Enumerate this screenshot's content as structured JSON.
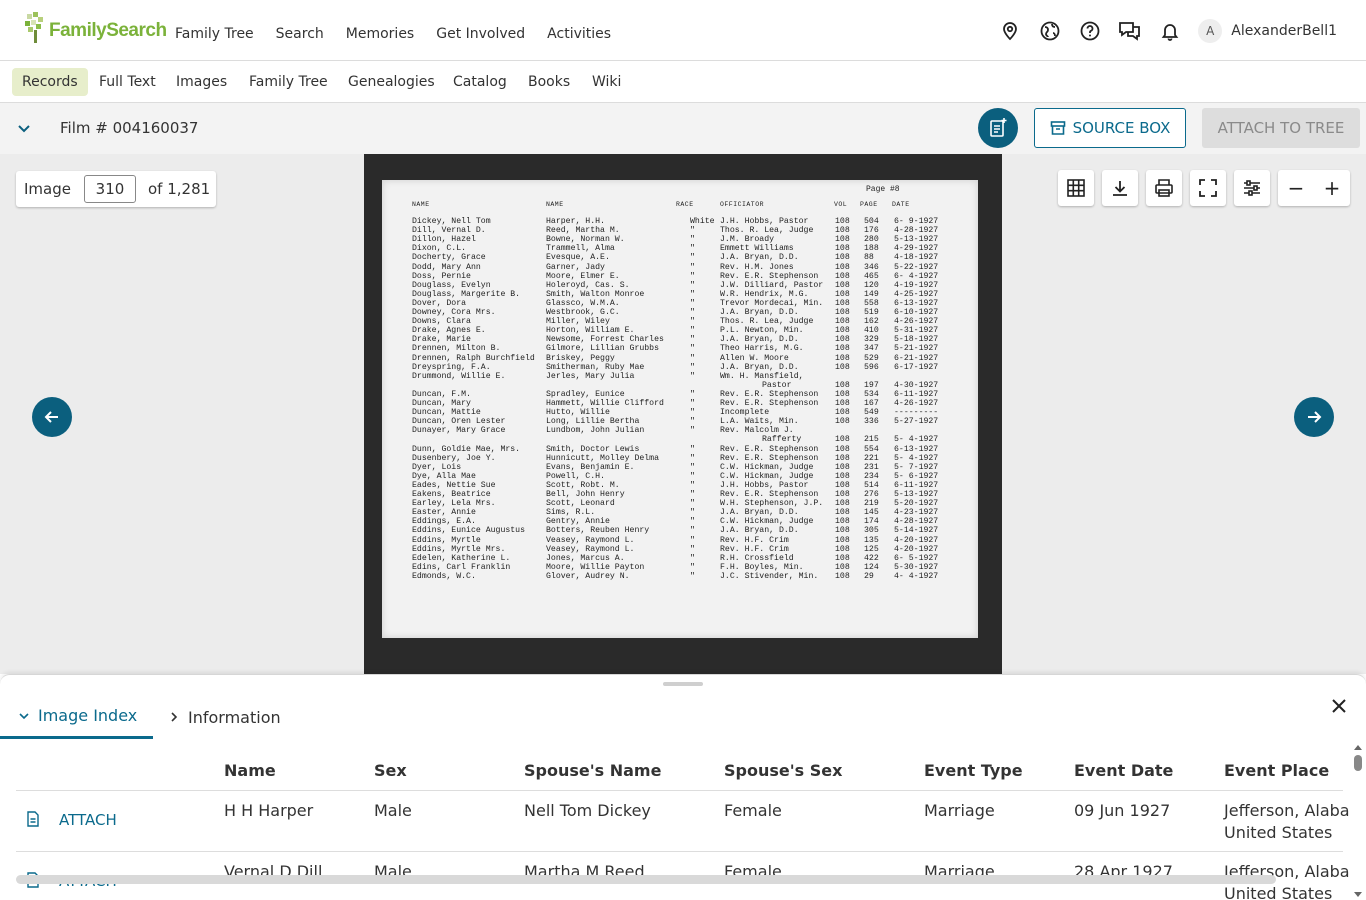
{
  "header": {
    "logo_text": "FamilySearch",
    "nav": [
      "Family Tree",
      "Search",
      "Memories",
      "Get Involved",
      "Activities"
    ],
    "icons": [
      "location-pin-icon",
      "globe-icon",
      "help-icon",
      "chat-icon",
      "bell-icon"
    ],
    "avatar_initial": "A",
    "username": "AlexanderBell1"
  },
  "subnav": {
    "items": [
      "Records",
      "Full Text",
      "Images",
      "Family Tree",
      "Genealogies",
      "Catalog",
      "Books",
      "Wiki"
    ],
    "active": "Records"
  },
  "filmbar": {
    "title": "Film # 004160037",
    "source_box_label": "SOURCE BOX",
    "attach_tree_label": "ATTACH TO TREE"
  },
  "viewer": {
    "image_label": "Image",
    "image_number": "310",
    "image_total": "of 1,281",
    "tools": [
      "grid-icon",
      "download-icon",
      "print-icon",
      "fullscreen-icon",
      "adjust-icon"
    ],
    "zoom_out": "−",
    "zoom_in": "+"
  },
  "document": {
    "page_label": "Page #8",
    "headers": [
      "NAME",
      "NAME",
      "RACE",
      "OFFICIATOR",
      "VOL",
      "PAGE",
      "DATE"
    ],
    "rows": [
      [
        "Dickey, Nell Tom",
        "Harper, H.H.",
        "White",
        "J.H. Hobbs, Pastor",
        "108",
        "504",
        "6- 9-1927"
      ],
      [
        "Dill, Vernal D.",
        "Reed, Martha M.",
        "\"",
        "Thos. R. Lea, Judge",
        "108",
        "176",
        "4-28-1927"
      ],
      [
        "Dillon, Hazel",
        "Bowne, Norman W.",
        "\"",
        "J.M. Broady",
        "108",
        "280",
        "5-13-1927"
      ],
      [
        "Dixon, C.L.",
        "Trammell, Alma",
        "\"",
        "Emmett Williams",
        "108",
        "188",
        "4-29-1927"
      ],
      [
        "Docherty, Grace",
        "Evesque, A.E.",
        "\"",
        "J.A. Bryan, D.D.",
        "108",
        "88",
        "4-18-1927"
      ],
      [
        "Dodd, Mary Ann",
        "Garner, Jady",
        "\"",
        "Rev. H.M. Jones",
        "108",
        "346",
        "5-22-1927"
      ],
      [
        "Doss, Pernie",
        "Moore, Elmer E.",
        "\"",
        "Rev. E.R. Stephenson",
        "108",
        "465",
        "6- 4-1927"
      ],
      [
        "Douglass, Evelyn",
        "Holeroyd, Cas. S.",
        "\"",
        "J.W. Dilliard, Pastor",
        "108",
        "120",
        "4-19-1927"
      ],
      [
        "Douglass, Margerite B.",
        "Smith, Walton Monroe",
        "\"",
        "W.R. Hendrix, M.G.",
        "108",
        "149",
        "4-25-1927"
      ],
      [
        "Dover, Dora",
        "Glassco, W.M.A.",
        "\"",
        "Trevor Mordecai, Min.",
        "108",
        "558",
        "6-13-1927"
      ],
      [
        "Downey, Cora Mrs.",
        "Westbrook, G.C.",
        "\"",
        "J.A. Bryan, D.D.",
        "108",
        "519",
        "6-10-1927"
      ],
      [
        "Downs, Clara",
        "Miller, Wiley",
        "\"",
        "Thos. R. Lea, Judge",
        "108",
        "162",
        "4-26-1927"
      ],
      [
        "Drake, Agnes E.",
        "Horton, William E.",
        "\"",
        "P.L. Newton, Min.",
        "108",
        "410",
        "5-31-1927"
      ],
      [
        "Drake, Marie",
        "Newsome, Forrest Charles",
        "\"",
        "J.A. Bryan, D.D.",
        "108",
        "329",
        "5-18-1927"
      ],
      [
        "Drennen, Milton B.",
        "Gilmore, Lillian Grubbs",
        "\"",
        "Theo Harris, M.G.",
        "108",
        "347",
        "5-21-1927"
      ],
      [
        "Drennen, Ralph Burchfield",
        "Briskey, Peggy",
        "\"",
        "Allen W. Moore",
        "108",
        "529",
        "6-21-1927"
      ],
      [
        "Dreyspring, F.A.",
        "Smitherman, Ruby Mae",
        "\"",
        "J.A. Bryan, D.D.",
        "108",
        "596",
        "6-17-1927"
      ],
      [
        "Drummond, Willie E.",
        "Jerles, Mary Julia",
        "\"",
        "Wm. H. Mansfield,",
        "",
        "",
        ""
      ],
      [
        "",
        "",
        "",
        "Pastor",
        "108",
        "197",
        "4-30-1927"
      ],
      [
        "Duncan, F.M.",
        "Spradley, Eunice",
        "\"",
        "Rev. E.R. Stephenson",
        "108",
        "534",
        "6-11-1927"
      ],
      [
        "Duncan, Mary",
        "Hammett, Willie Clifford",
        "\"",
        "Rev. E.R. Stephenson",
        "108",
        "167",
        "4-26-1927"
      ],
      [
        "Duncan, Mattie",
        "Hutto, Willie",
        "\"",
        "Incomplete",
        "108",
        "549",
        "---------"
      ],
      [
        "Duncan, Oren Lester",
        "Long, Lillie Bertha",
        "\"",
        "L.A. Waits, Min.",
        "108",
        "336",
        "5-27-1927"
      ],
      [
        "Dunayer, Mary Grace",
        "Lundbom, John Julian",
        "\"",
        "Rev. Malcolm J.",
        "",
        "",
        ""
      ],
      [
        "",
        "",
        "",
        "Rafferty",
        "108",
        "215",
        "5- 4-1927"
      ],
      [
        "Dunn, Goldie Mae, Mrs.",
        "Smith, Doctor Lewis",
        "\"",
        "Rev. E.R. Stephenson",
        "108",
        "554",
        "6-13-1927"
      ],
      [
        "Dusenbery, Joe Y.",
        "Hunnicutt, Molley Delma",
        "\"",
        "Rev. E.R. Stephenson",
        "108",
        "221",
        "5- 4-1927"
      ],
      [
        "Dyer, Lois",
        "Evans, Benjamin E.",
        "\"",
        "C.W. Hickman, Judge",
        "108",
        "231",
        "5- 7-1927"
      ],
      [
        "Dye, Alla Mae",
        "Powell, C.H.",
        "\"",
        "C.W. Hickman, Judge",
        "108",
        "234",
        "5- 6-1927"
      ],
      [
        "Eades, Nettie Sue",
        "Scott, Robt. M.",
        "\"",
        "J.H. Hobbs, Pastor",
        "108",
        "514",
        "6-11-1927"
      ],
      [
        "Eakens, Beatrice",
        "Bell, John Henry",
        "\"",
        "Rev. E.R. Stephenson",
        "108",
        "276",
        "5-13-1927"
      ],
      [
        "Earley, Lela Mrs.",
        "Scott, Leonard",
        "\"",
        "W.H. Stephenson, J.P.",
        "108",
        "219",
        "5-20-1927"
      ],
      [
        "Easter, Annie",
        "Sims, R.L.",
        "\"",
        "J.A. Bryan, D.D.",
        "108",
        "145",
        "4-23-1927"
      ],
      [
        "Eddings, E.A.",
        "Gentry, Annie",
        "\"",
        "C.W. Hickman, Judge",
        "108",
        "174",
        "4-28-1927"
      ],
      [
        "Eddins, Eunice Augustus",
        "Botters, Reuben Henry",
        "\"",
        "J.A. Bryan, D.D.",
        "108",
        "305",
        "5-14-1927"
      ],
      [
        "Eddins, Myrtle",
        "Veasey, Raymond L.",
        "\"",
        "Rev. H.F. Crim",
        "108",
        "135",
        "4-20-1927"
      ],
      [
        "Eddins, Myrtle Mrs.",
        "Veasey, Raymond L.",
        "\"",
        "Rev. H.F. Crim",
        "108",
        "125",
        "4-20-1927"
      ],
      [
        "Edelen, Katherine L.",
        "Jones, Marcus A.",
        "\"",
        "R.H. Crossfield",
        "108",
        "422",
        "6- 5-1927"
      ],
      [
        "Edins, Carl Franklin",
        "Moore, Willie Payton",
        "\"",
        "F.H. Boyles, Min.",
        "108",
        "124",
        "5-30-1927"
      ],
      [
        "Edmonds, W.C.",
        "Glover, Audrey N.",
        "\"",
        "J.C. Stivender, Min.",
        "108",
        "29",
        "4- 4-1927"
      ]
    ]
  },
  "panel": {
    "tab_index": "Image Index",
    "tab_info": "Information",
    "columns": [
      "Name",
      "Sex",
      "Spouse's Name",
      "Spouse's Sex",
      "Event Type",
      "Event Date",
      "Event Place"
    ],
    "attach_label": "ATTACH",
    "rows": [
      {
        "name": "H H Harper",
        "sex": "Male",
        "spouse": "Nell Tom Dickey",
        "spouse_sex": "Female",
        "event_type": "Marriage",
        "event_date": "09 Jun 1927",
        "place1": "Jefferson, Alaba",
        "place2": "United States"
      },
      {
        "name": "Vernal D Dill",
        "sex": "Male",
        "spouse": "Martha M Reed",
        "spouse_sex": "Female",
        "event_type": "Marriage",
        "event_date": "28 Apr 1927",
        "place1": "Jefferson, Alaba",
        "place2": "United States"
      }
    ]
  },
  "colors": {
    "brand_green": "#7bb23a",
    "accent_teal": "#0b5f7e",
    "active_tab_bg": "#e7eecb"
  }
}
